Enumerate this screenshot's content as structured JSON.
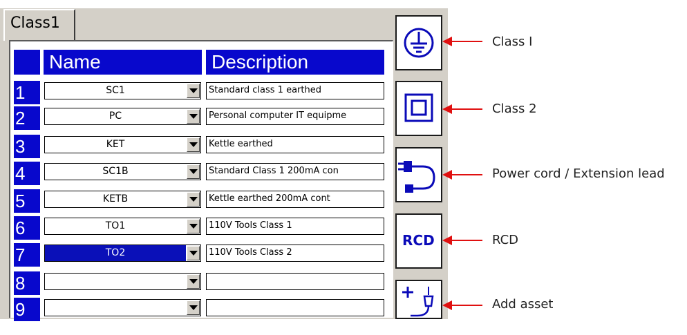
{
  "tab": {
    "label": "Class1"
  },
  "grid": {
    "headers": {
      "name": "Name",
      "description": "Description"
    },
    "rows": [
      {
        "num": "1",
        "name": "SC1",
        "description": "Standard class 1 earthed"
      },
      {
        "num": "2",
        "name": "PC",
        "description": "Personal computer IT equipme"
      },
      {
        "num": "3",
        "name": "KET",
        "description": "Kettle earthed"
      },
      {
        "num": "4",
        "name": "SC1B",
        "description": "Standard Class 1 200mA con"
      },
      {
        "num": "5",
        "name": "KETB",
        "description": "Kettle earthed 200mA cont"
      },
      {
        "num": "6",
        "name": "TO1",
        "description": "110V Tools Class 1"
      },
      {
        "num": "7",
        "name": "TO2",
        "description": "110V Tools Class 2"
      },
      {
        "num": "8",
        "name": "",
        "description": ""
      },
      {
        "num": "9",
        "name": "",
        "description": ""
      }
    ],
    "selected_row": 7
  },
  "side_buttons": {
    "class1": {
      "icon": "earth-ground-icon"
    },
    "class2": {
      "icon": "double-square-icon"
    },
    "power_cord": {
      "icon": "plug-cord-icon"
    },
    "rcd": {
      "label": "RCD"
    },
    "add_asset": {
      "icon": "add-plug-icon"
    }
  },
  "callouts": {
    "class1": "Class I",
    "class2": "Class 2",
    "power_cord": "Power cord / Extension lead",
    "rcd": "RCD",
    "add_asset": "Add asset"
  },
  "colors": {
    "header_blue": "#0808cc",
    "panel_gray": "#d4d0c8",
    "icon_blue": "#0a0ab8",
    "arrow_red": "#e01010"
  }
}
